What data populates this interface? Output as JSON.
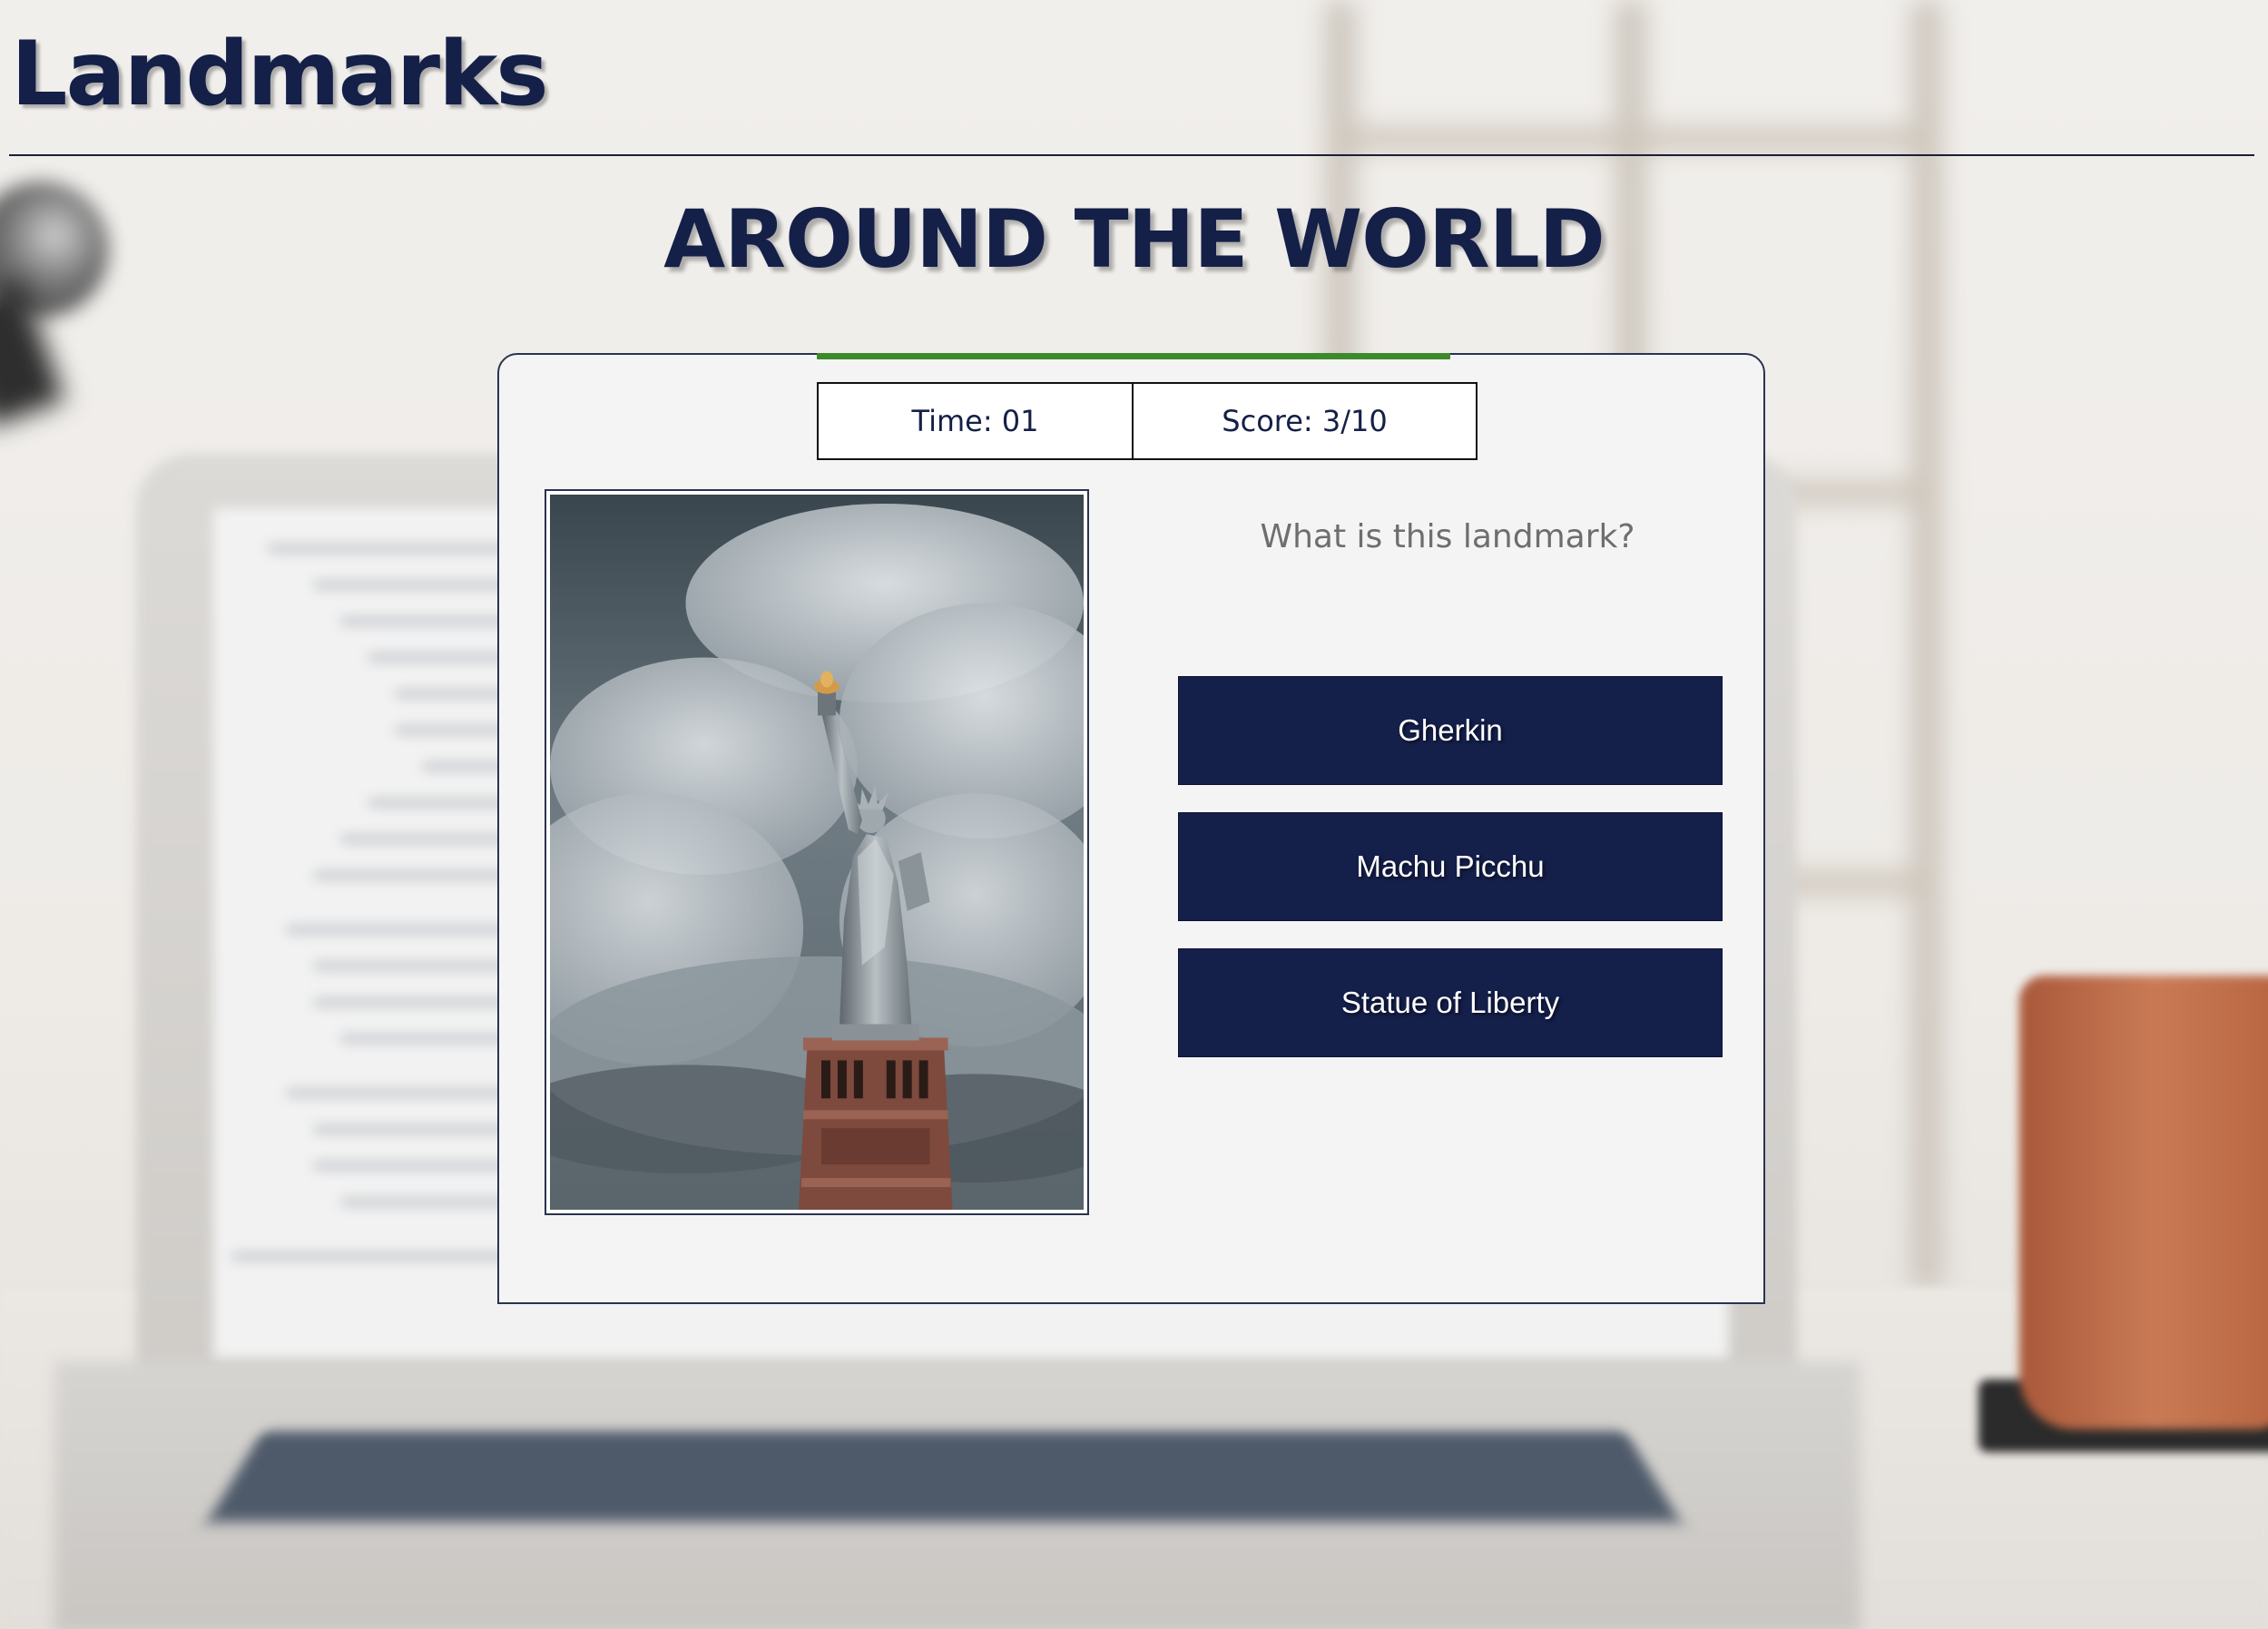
{
  "site": {
    "title": "Landmarks"
  },
  "quiz": {
    "subtitle": "AROUND THE WORLD",
    "progress_fraction": 0.3,
    "time_label": "Time: 01",
    "score_label": "Score: 3/10",
    "question": "What is this landmark?",
    "answers": [
      {
        "label": "Gherkin"
      },
      {
        "label": "Machu Picchu"
      },
      {
        "label": "Statue of Liberty"
      }
    ]
  },
  "colors": {
    "navy": "#142048",
    "progress_green": "#3d8a2a",
    "card_background": "#f4f4f4",
    "question_grey": "#6e6e6e"
  }
}
